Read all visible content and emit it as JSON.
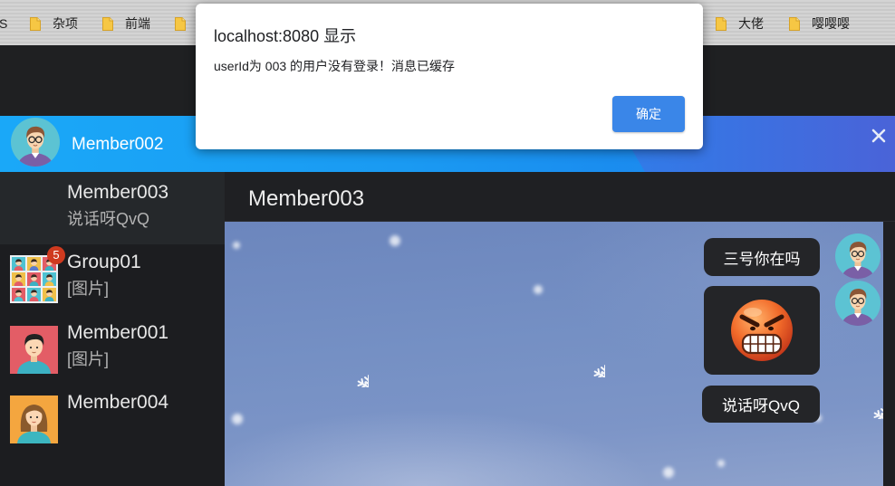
{
  "bookmarks": {
    "partial_left": "S",
    "items": [
      {
        "label": "杂项",
        "icon": "folder-icon"
      },
      {
        "label": "前端",
        "icon": "folder-icon"
      },
      {
        "icon": "folder-icon"
      },
      {
        "label": "大佬",
        "icon": "folder-icon"
      },
      {
        "label": "嘤嘤嘤",
        "icon": "folder-icon"
      }
    ]
  },
  "dialog": {
    "title": "localhost:8080 显示",
    "message": "userId为 003 的用户没有登录！消息已缓存",
    "ok_label": "确定"
  },
  "header": {
    "user_name": "Member002",
    "avatar_icon": "man-with-glasses-avatar",
    "close_icon": "close-icon"
  },
  "contacts": [
    {
      "name": "Member003",
      "last_message": "说话呀QvQ",
      "selected": true,
      "avatar_icon": "empty-avatar"
    },
    {
      "name": "Group01",
      "last_message": "[图片]",
      "unread_count": "5",
      "avatar_icon": "group-grid-avatar"
    },
    {
      "name": "Member001",
      "last_message": "[图片]",
      "avatar_icon": "man-avatar"
    },
    {
      "name": "Member004",
      "avatar_icon": "woman-avatar"
    }
  ],
  "chat": {
    "title": "Member003",
    "background_icon": "snowflake-icon",
    "messages": [
      {
        "text": "三号你在吗",
        "avatar_icon": "man-with-glasses-avatar"
      },
      {
        "image_icon": "angry-face-emoji",
        "avatar_icon": "man-with-glasses-avatar"
      },
      {
        "text": "说话呀QvQ"
      }
    ]
  },
  "colors": {
    "header_blue": "#1aa8f8",
    "header_blue_dark": "#3f6ee0",
    "dialog_button": "#3a86e8",
    "badge_red": "#cf3a1f",
    "sidebar_bg": "#1c1d20",
    "selected_contact_bg": "#25282b",
    "bubble_bg": "#242528",
    "chat_bg": "#7590c4"
  }
}
